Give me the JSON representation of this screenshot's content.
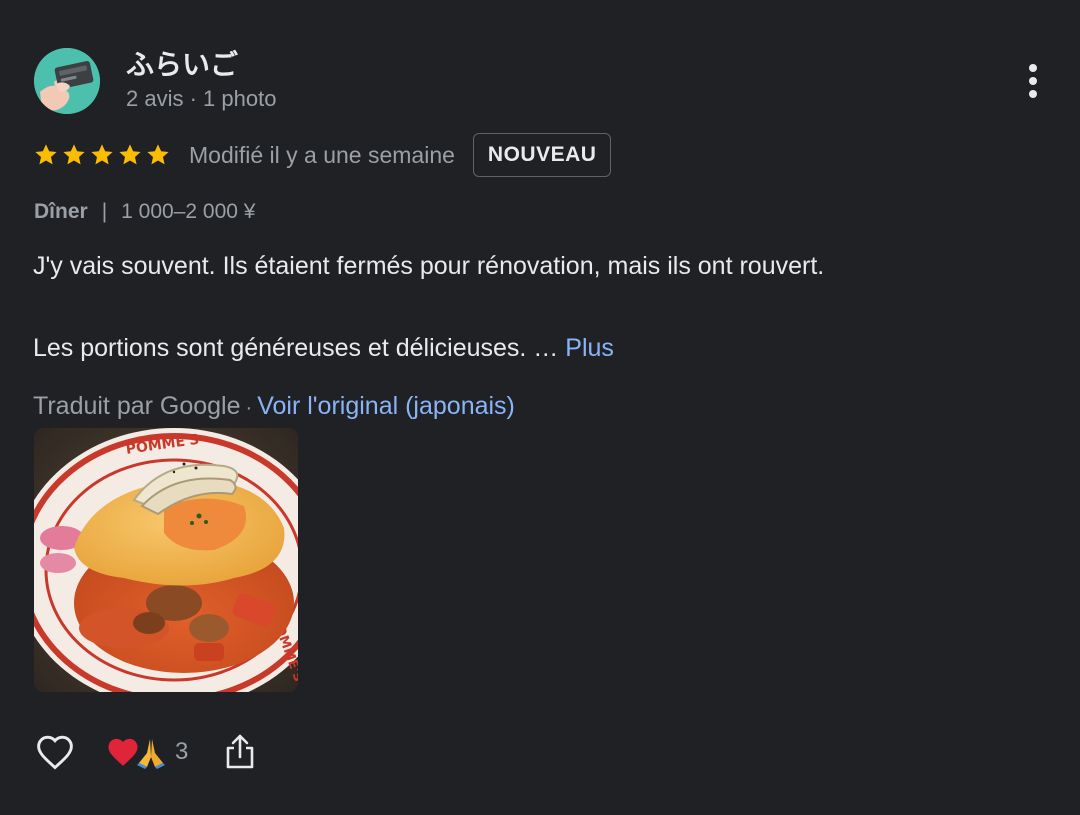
{
  "reviewer": {
    "name": "ふらいご",
    "meta": "2 avis · 1 photo"
  },
  "rating": {
    "stars": 5,
    "edited": "Modifié il y a une semaine",
    "badge": "NOUVEAU"
  },
  "meal": {
    "type": "Dîner",
    "separator": "|",
    "price": "1 000–2 000 ¥"
  },
  "review": {
    "line1": "J'y vais souvent. Ils étaient fermés pour rénovation, mais ils ont rouvert.",
    "line2": "Les portions sont généreuses et délicieuses. …",
    "more_label": "Plus"
  },
  "translation": {
    "label": "Traduit par Google",
    "separator": "·",
    "link": "Voir l'original (japonais)"
  },
  "photo": {
    "plate_text_top": "POMME'S",
    "plate_text_side": "POMME'S"
  },
  "actions": {
    "reaction_count": "3",
    "like_icon": "heart-outline-icon",
    "share_icon": "share-icon",
    "reaction_icons": [
      "red-heart-emoji",
      "folded-hands-emoji"
    ]
  },
  "colors": {
    "background": "#202124",
    "star": "#fbbc04",
    "link": "#8ab4f8",
    "secondary_text": "#9aa0a6",
    "primary_text": "#e8eaed"
  }
}
